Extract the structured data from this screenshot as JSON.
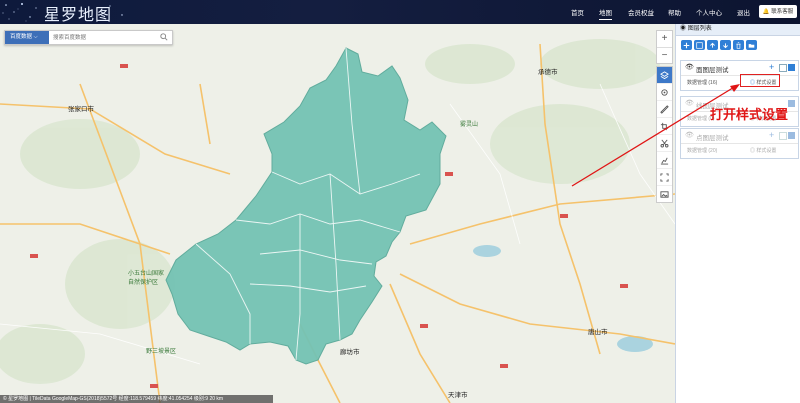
{
  "header": {
    "brand": "星罗地图",
    "nav": [
      "首页",
      "地图",
      "会员权益",
      "帮助",
      "个人中心",
      "退出"
    ],
    "active_nav": "地图",
    "contact": "联系客服"
  },
  "search": {
    "source": "百度数据",
    "placeholder": "搜索百度数据"
  },
  "map": {
    "region_color": "#74c3b4",
    "labels": {
      "zhangjiakou": "张家口市",
      "chengde": "承德市",
      "tangshan": "唐山市",
      "tianjin": "天津市",
      "langfang": "廊坊市",
      "yesanpo": "野三坡景区",
      "xiaowutai": "小五台山国家\n自然保护区",
      "wuling": "雾灵山"
    }
  },
  "status": "© 星罗地图 | TileData GoogleMap-GS(2018)5572号  经度:118.579459  纬度:41.054254  级别:9   20 km",
  "panel": {
    "title": "图层列表",
    "layers": [
      {
        "name": "面图层测试",
        "data_manage": "数据管理 (16)",
        "style": "样式设置"
      },
      {
        "name": "线图层测试",
        "data_manage": "数据管理 (0)",
        "style": "样式设置"
      },
      {
        "name": "点图层测试",
        "data_manage": "数据管理 (20)",
        "style": "样式设置"
      }
    ]
  },
  "annotation": "打开样式设置",
  "colors": {
    "accent": "#2f7fd6",
    "header_bg": "#0e1a3c",
    "annotation": "#e01515"
  }
}
